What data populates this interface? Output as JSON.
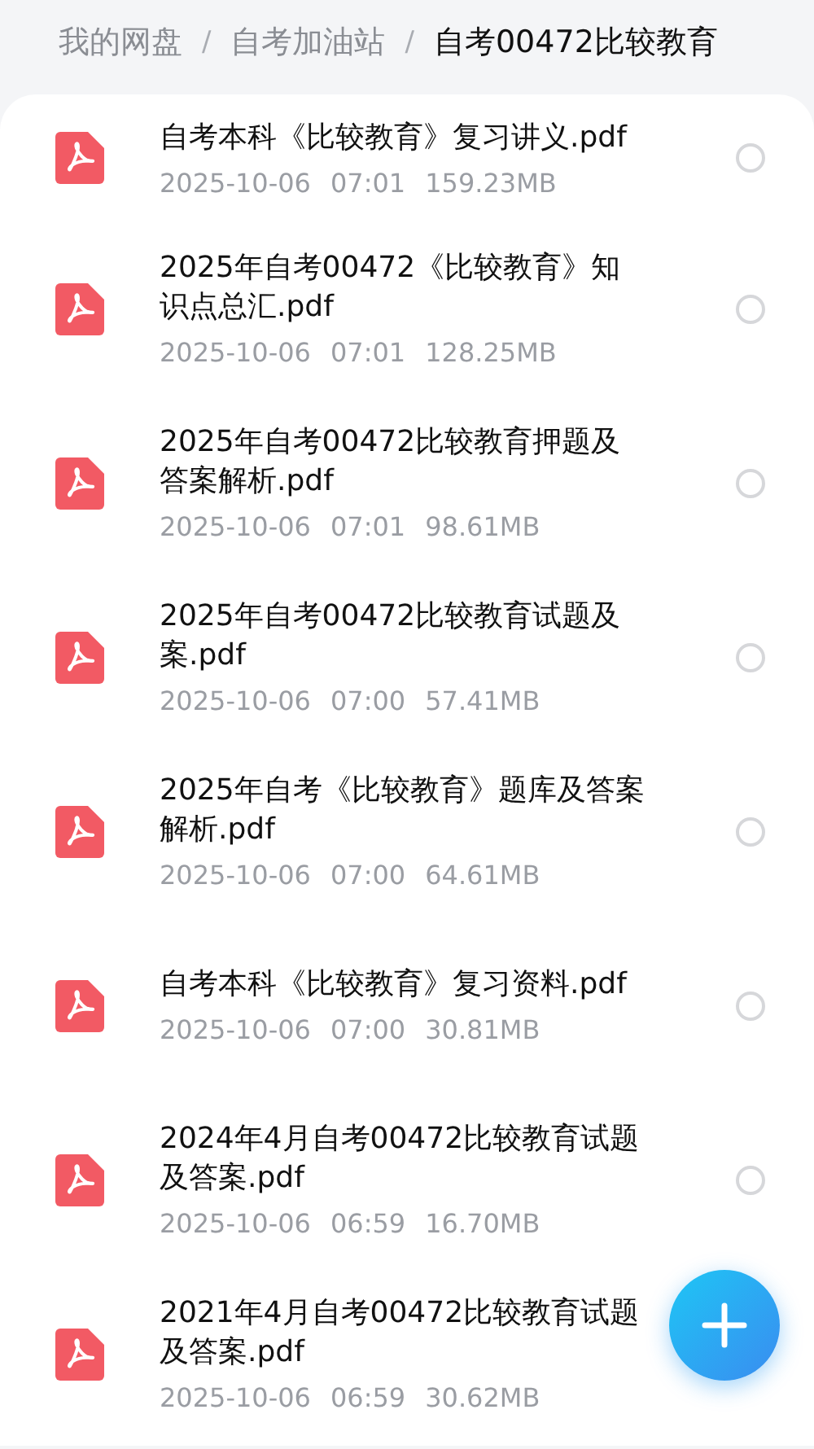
{
  "breadcrumb": [
    {
      "label": "我的网盘",
      "current": false
    },
    {
      "label": "自考加油站",
      "current": false
    },
    {
      "label": "自考00472比较教育",
      "current": true
    }
  ],
  "breadcrumb_separator": "/",
  "files": [
    {
      "name": "自考本科《比较教育》复习讲义.pdf",
      "date": "2025-10-06",
      "time": "07:01",
      "size": "159.23MB",
      "selected": false
    },
    {
      "name": "2025年自考00472《比较教育》知识点总汇.pdf",
      "date": "2025-10-06",
      "time": "07:01",
      "size": "128.25MB",
      "selected": false
    },
    {
      "name": "2025年自考00472比较教育押题及答案解析.pdf",
      "date": "2025-10-06",
      "time": "07:01",
      "size": "98.61MB",
      "selected": false
    },
    {
      "name": "2025年自考00472比较教育试题及案.pdf",
      "date": "2025-10-06",
      "time": "07:00",
      "size": "57.41MB",
      "selected": false
    },
    {
      "name": "2025年自考《比较教育》题库及答案解析.pdf",
      "date": "2025-10-06",
      "time": "07:00",
      "size": "64.61MB",
      "selected": false
    },
    {
      "name": "自考本科《比较教育》复习资料.pdf",
      "date": "2025-10-06",
      "time": "07:00",
      "size": "30.81MB",
      "selected": false
    },
    {
      "name": "2024年4月自考00472比较教育试题及答案.pdf",
      "date": "2025-10-06",
      "time": "06:59",
      "size": "16.70MB",
      "selected": false
    },
    {
      "name": "2021年4月自考00472比较教育试题及答案.pdf",
      "date": "2025-10-06",
      "time": "06:59",
      "size": "30.62MB"
    }
  ]
}
